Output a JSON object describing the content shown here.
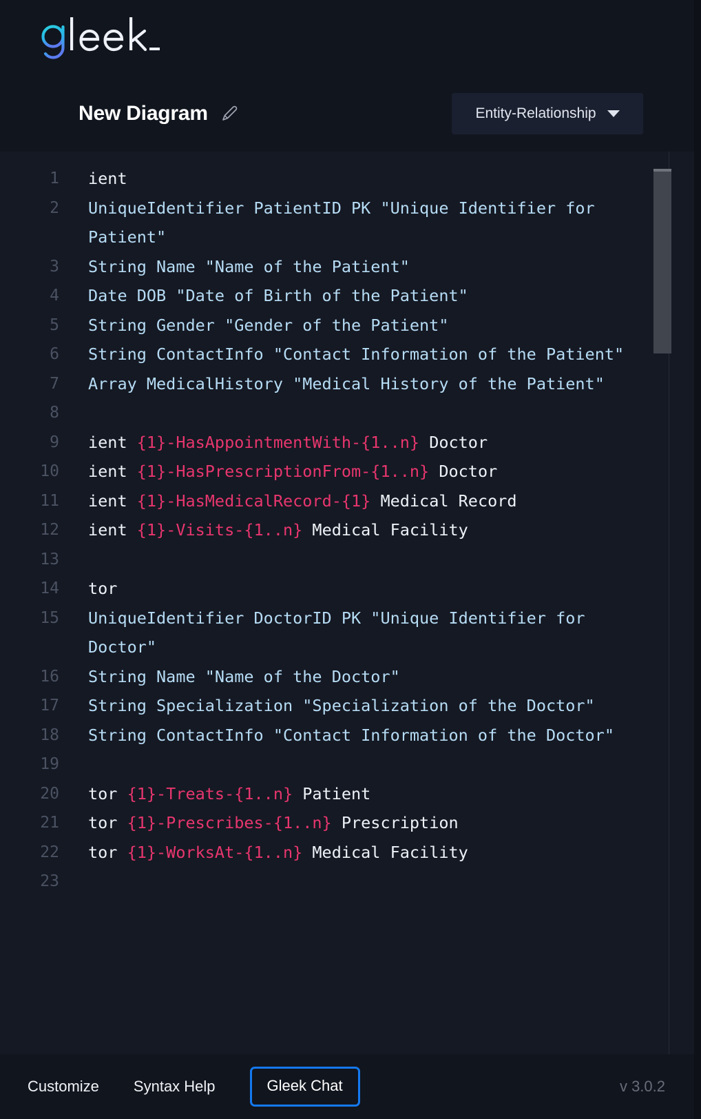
{
  "brand": {
    "name": "gleek_",
    "logo_icon": "gleek-wordmark"
  },
  "header": {
    "diagram_title": "New Diagram",
    "edit_icon": "pencil-icon",
    "diagram_type": "Entity-Relationship",
    "caret_icon": "chevron-down-icon"
  },
  "editor": {
    "lines": [
      {
        "n": "1",
        "segments": [
          {
            "text": "ient",
            "cls": "tok-ent"
          }
        ]
      },
      {
        "n": "2",
        "segments": [
          {
            "text": "UniqueIdentifier PatientID PK \"Unique Identifier for Patient\"",
            "cls": "tok-attr"
          }
        ]
      },
      {
        "n": "3",
        "segments": [
          {
            "text": "String Name \"Name of the Patient\"",
            "cls": "tok-attr"
          }
        ]
      },
      {
        "n": "4",
        "segments": [
          {
            "text": "Date DOB \"Date of Birth of the Patient\"",
            "cls": "tok-attr"
          }
        ]
      },
      {
        "n": "5",
        "segments": [
          {
            "text": "String Gender \"Gender of the Patient\"",
            "cls": "tok-attr"
          }
        ]
      },
      {
        "n": "6",
        "segments": [
          {
            "text": "String ContactInfo \"Contact Information of the Patient\"",
            "cls": "tok-attr"
          }
        ]
      },
      {
        "n": "7",
        "segments": [
          {
            "text": "Array MedicalHistory \"Medical History of the Patient\"",
            "cls": "tok-attr"
          }
        ]
      },
      {
        "n": "8",
        "segments": []
      },
      {
        "n": "9",
        "segments": [
          {
            "text": "ient ",
            "cls": "tok-ent"
          },
          {
            "text": "{1}-HasAppointmentWith-{1..n}",
            "cls": "tok-rel"
          },
          {
            "text": " Doctor",
            "cls": "tok-ent"
          }
        ]
      },
      {
        "n": "10",
        "segments": [
          {
            "text": "ient ",
            "cls": "tok-ent"
          },
          {
            "text": "{1}-HasPrescriptionFrom-{1..n}",
            "cls": "tok-rel"
          },
          {
            "text": " Doctor",
            "cls": "tok-ent"
          }
        ]
      },
      {
        "n": "11",
        "segments": [
          {
            "text": "ient ",
            "cls": "tok-ent"
          },
          {
            "text": "{1}-HasMedicalRecord-{1}",
            "cls": "tok-rel"
          },
          {
            "text": " Medical Record",
            "cls": "tok-ent"
          }
        ]
      },
      {
        "n": "12",
        "segments": [
          {
            "text": "ient ",
            "cls": "tok-ent"
          },
          {
            "text": "{1}-Visits-{1..n}",
            "cls": "tok-rel"
          },
          {
            "text": " Medical Facility",
            "cls": "tok-ent"
          }
        ]
      },
      {
        "n": "13",
        "segments": []
      },
      {
        "n": "14",
        "segments": [
          {
            "text": "tor",
            "cls": "tok-ent"
          }
        ]
      },
      {
        "n": "15",
        "segments": [
          {
            "text": "UniqueIdentifier DoctorID PK \"Unique Identifier for Doctor\"",
            "cls": "tok-attr"
          }
        ]
      },
      {
        "n": "16",
        "segments": [
          {
            "text": "String Name \"Name of the Doctor\"",
            "cls": "tok-attr"
          }
        ]
      },
      {
        "n": "17",
        "segments": [
          {
            "text": "String Specialization \"Specialization of the Doctor\"",
            "cls": "tok-attr"
          }
        ]
      },
      {
        "n": "18",
        "segments": [
          {
            "text": "String ContactInfo \"Contact Information of the Doctor\"",
            "cls": "tok-attr"
          }
        ]
      },
      {
        "n": "19",
        "segments": []
      },
      {
        "n": "20",
        "segments": [
          {
            "text": "tor ",
            "cls": "tok-ent"
          },
          {
            "text": "{1}-Treats-{1..n}",
            "cls": "tok-rel"
          },
          {
            "text": " Patient",
            "cls": "tok-ent"
          }
        ]
      },
      {
        "n": "21",
        "segments": [
          {
            "text": "tor ",
            "cls": "tok-ent"
          },
          {
            "text": "{1}-Prescribes-{1..n}",
            "cls": "tok-rel"
          },
          {
            "text": " Prescription",
            "cls": "tok-ent"
          }
        ]
      },
      {
        "n": "22",
        "segments": [
          {
            "text": "tor ",
            "cls": "tok-ent"
          },
          {
            "text": "{1}-WorksAt-{1..n}",
            "cls": "tok-rel"
          },
          {
            "text": " Medical Facility",
            "cls": "tok-ent"
          }
        ]
      },
      {
        "n": "23",
        "segments": []
      }
    ]
  },
  "footer": {
    "customize_label": "Customize",
    "syntax_help_label": "Syntax Help",
    "gleek_chat_label": "Gleek Chat",
    "version": "v 3.0.2"
  },
  "colors": {
    "app_bg": "#11151e",
    "editor_bg": "#151923",
    "accent_blue": "#1479ef",
    "attribute_text": "#b6dcf5",
    "relationship_text": "#e8366e",
    "entity_text": "#eef2f8",
    "line_number": "#4b5263",
    "select_bg": "#1b2030"
  }
}
